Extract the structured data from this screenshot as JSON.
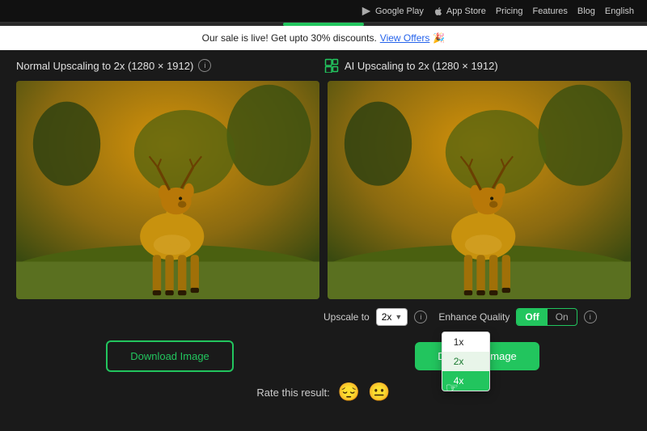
{
  "topNav": {
    "googlePlay": "Google Play",
    "appStore": "App Store",
    "pricing": "Pricing",
    "features": "Features",
    "blog": "Blog",
    "language": "English"
  },
  "saleBanner": {
    "text": "Our sale is live! Get upto 30% discounts.",
    "linkText": "View Offers",
    "emoji": "🎉"
  },
  "labels": {
    "normal": "Normal Upscaling to 2x (1280 × 1912)",
    "ai": "AI Upscaling to 2x (1280 × 1912)"
  },
  "controls": {
    "upscaleLabel": "Upscale to",
    "selectedScale": "2x",
    "infoTooltip": "i",
    "enhanceLabel": "Enhance Quality",
    "toggleOff": "Off",
    "toggleOn": "On",
    "dropdownOptions": [
      "1x",
      "2x",
      "4x"
    ]
  },
  "buttons": {
    "downloadNormal": "Download Image",
    "downloadAI": "Download Image"
  },
  "rating": {
    "label": "Rate this result:",
    "sadEmoji": "😔",
    "neutralEmoji": "😐"
  }
}
